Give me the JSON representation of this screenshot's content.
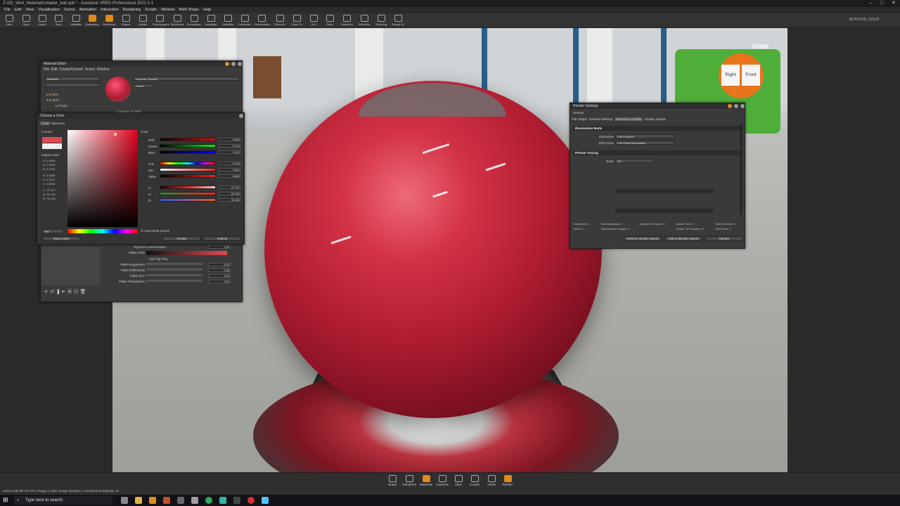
{
  "window": {
    "title": "Z:\\3D_Wed_Materials\\shader_ball.vpb * - Autodesk VRED Professional 2022.0.1"
  },
  "menu": [
    "File",
    "Edit",
    "View",
    "Visualization",
    "Scene",
    "Animation",
    "Interaction",
    "Rendering",
    "Scripts",
    "Window",
    "Web Shops",
    "Help"
  ],
  "toolbar": [
    "New",
    "Open",
    "Import",
    "Save",
    "Antialias",
    "Raytracing",
    "Omnicircle",
    "Region",
    "Isolate",
    "Scenegraphs",
    "Wireframe",
    "Boundings",
    "Headlight",
    "Statistics",
    "Fullscreen",
    "Presentation",
    "Show All",
    "Zoom To",
    "Grid",
    "Ruler",
    "Transform",
    "Selection",
    "Texturing",
    "Simple UI"
  ],
  "toolbar_right": "AUTOCAD_SOLID",
  "material_editor": {
    "title": "Material Editor",
    "menu": [
      "File",
      "Edit",
      "Create/Convert",
      "Scene",
      "Window"
    ],
    "filter_label": "Materials",
    "tree": [
      "ENV",
      "MISC",
      "Plastic"
    ],
    "name": "Carpaint_Scratch",
    "tag": "Scene",
    "selected_item": "Carpaint_Scratch",
    "props": {
      "pigment_concentration": {
        "label": "Pigment Concentration",
        "value": "1.00"
      },
      "flake_color": {
        "label": "Flake Color"
      },
      "use_flip_flop": "Use Flip Flop",
      "flake_roughness": {
        "label": "Flake Roughness",
        "value": "0.03"
      },
      "flake_reflectivity": {
        "label": "Flake Reflectivity",
        "value": "0.85"
      },
      "flake_size": {
        "label": "Flake Size",
        "value": "5.00"
      },
      "flake_perturbation": {
        "label": "Flake Perturbation",
        "value": "2.00"
      }
    }
  },
  "color_dialog": {
    "title": "Choose a Color",
    "tabs": [
      "Color",
      "Spectrum"
    ],
    "current_label": "Current",
    "output_label": "Output Color",
    "readouts": [
      "R: 0.8836",
      "G: 0.0763",
      "B: 0.0763",
      "H: 0.0000",
      "S: 0.9312",
      "V: 0.8836",
      "L*: 57.217",
      "a*: 82.192",
      "b*: 33.922"
    ],
    "color_label": "Color",
    "sliders": [
      {
        "name": "Red",
        "value": "0.852"
      },
      {
        "name": "Green",
        "value": "0.113"
      },
      {
        "name": "Blue",
        "value": "0.112"
      },
      {
        "name": "Hue",
        "value": "0.000"
      },
      {
        "name": "Sat",
        "value": "0.811"
      },
      {
        "name": "Value",
        "value": "0.852"
      },
      {
        "name": "L*",
        "value": "57.217"
      },
      {
        "name": "a*",
        "value": "82.192"
      },
      {
        "name": "b*",
        "value": "33.922"
      }
    ],
    "mode_select": "Flat",
    "use_srgb": "Use sRGB Colors",
    "store_color": "Store Color",
    "accept": "Accept",
    "cancel": "Cancel",
    "current_color": "#e04a52",
    "output_color": "#f0f0f0"
  },
  "render_settings": {
    "title": "Render Settings",
    "presets": "Presets",
    "tabs": [
      "File Output",
      "General Settings",
      "Raytracing Quality",
      "Display Output"
    ],
    "active_tab": "Raytracing Quality",
    "illum_section": "Illumination Mode",
    "interactive_label": "Interactive",
    "interactive_value": "Precomputed",
    "still_label": "Still Frame",
    "still_value": "Full Global Illumination",
    "photon_section": "Photon Tracing",
    "mode_label": "Mode",
    "mode_value": "Off",
    "stats": [
      [
        "Viewpoints: 1",
        "Renderpasses: 0",
        "Animation Frames: 0",
        "Variant Sets: 0",
        "Total Renders: 1"
      ],
      [
        "Stereo: 1",
        "Renderpass Images: 0",
        "",
        "Variant Set Renders: 0",
        "Total Files: 1"
      ]
    ],
    "send_cluster": "Send to Cluster Queue",
    "add_queue": "Add to Render Queue",
    "render": "Render"
  },
  "navcube": {
    "home": "HOME",
    "right": "Right",
    "front": "Front"
  },
  "bottom_tools": [
    "Graph",
    "Transform",
    "Materials",
    "Cameras",
    "Clips",
    "Curves",
    "VSets",
    "Render"
  ],
  "status_text": "4312.2 MB  RR-RT CPU Usage 1.138%  Image Samples: 1  Rendertime Elapsed: 0s",
  "taskbar": {
    "search_placeholder": "Type here to search"
  },
  "colors": {
    "accent": "#e08a1e",
    "paint": "#b11d31"
  }
}
